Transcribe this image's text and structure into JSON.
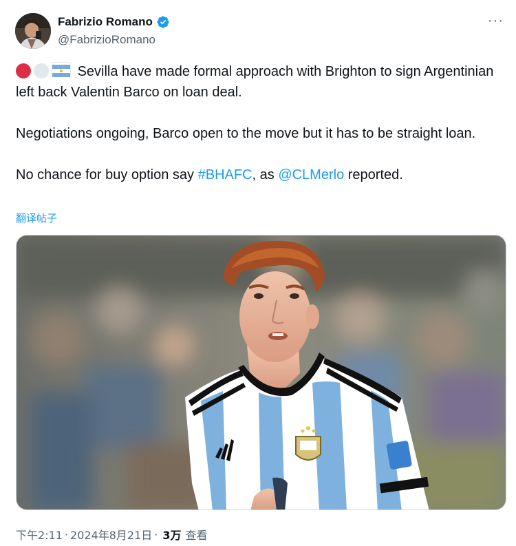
{
  "author": {
    "display_name": "Fabrizio Romano",
    "handle": "@FabrizioRomano",
    "verified": true
  },
  "more_icon": "···",
  "tweet": {
    "emoji_prefix": [
      "red-circle",
      "white-circle",
      "argentina-flag"
    ],
    "line1_text": "Sevilla have made formal approach with Brighton to sign Argentinian left back Valentin Barco on loan deal.",
    "para2": "Negotiations ongoing, Barco open to the move but it has to be straight loan.",
    "para3_before": "No chance for buy option say ",
    "hashtag": "#BHAFC",
    "para3_middle": ", as ",
    "mention": "@CLMerlo",
    "para3_after": " reported."
  },
  "translate_label": "翻译帖子",
  "footer": {
    "time": "下午2:11",
    "separator": "·",
    "date": "2024年8月21日",
    "views_count": "3万",
    "views_label": "查看"
  },
  "colors": {
    "link": "#1d9bf0",
    "verified": "#1d9bf0",
    "secondary_text": "#536471"
  }
}
